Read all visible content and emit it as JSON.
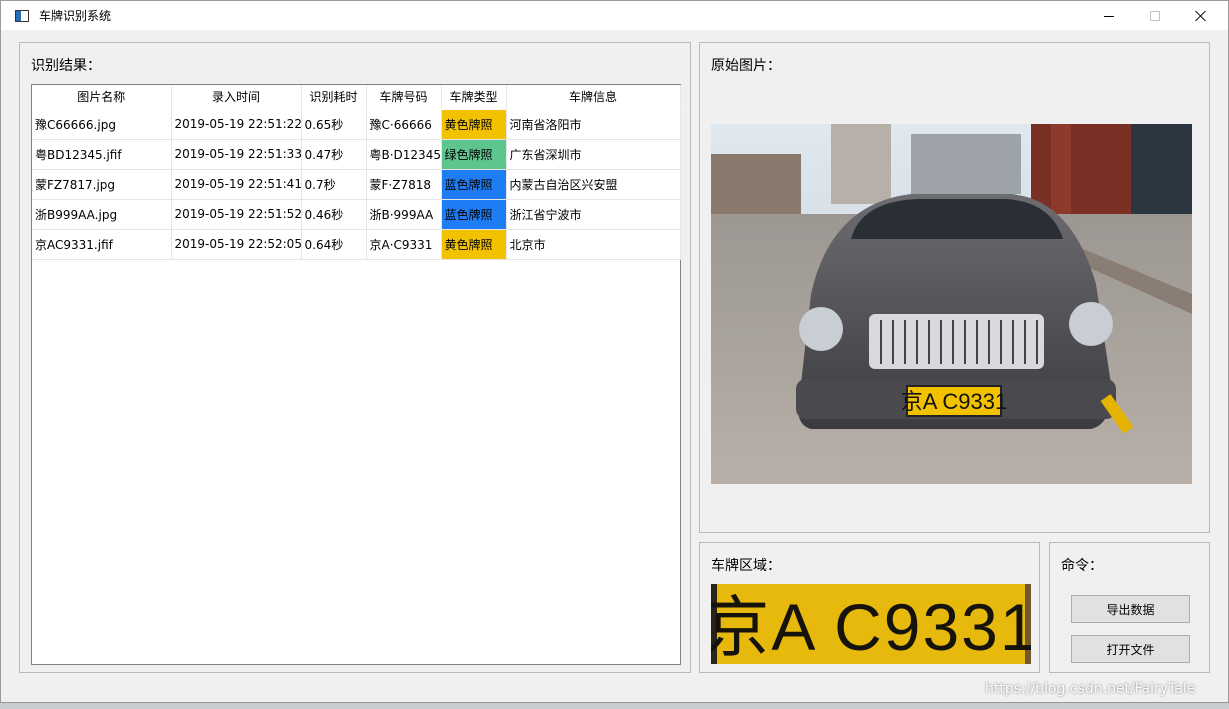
{
  "window": {
    "title": "车牌识别系统"
  },
  "results": {
    "title": "识别结果：",
    "columns": [
      "图片名称",
      "录入时间",
      "识别耗时",
      "车牌号码",
      "车牌类型",
      "车牌信息"
    ],
    "rows": [
      {
        "name": "豫C66666.jpg",
        "time": "2019-05-19 22:51:22",
        "cost": "0.65秒",
        "plate": "豫C·66666",
        "type": "黄色牌照",
        "type_color": "#f2c200",
        "info": "河南省洛阳市"
      },
      {
        "name": "粤BD12345.jfif",
        "time": "2019-05-19 22:51:33",
        "cost": "0.47秒",
        "plate": "粤B·D12345",
        "type": "绿色牌照",
        "type_color": "#5ec58f",
        "info": "广东省深圳市"
      },
      {
        "name": "蒙FZ7817.jpg",
        "time": "2019-05-19 22:51:41",
        "cost": "0.7秒",
        "plate": "蒙F·Z7818",
        "type": "蓝色牌照",
        "type_color": "#1e7cf5",
        "info": "内蒙古自治区兴安盟"
      },
      {
        "name": "浙B999AA.jpg",
        "time": "2019-05-19 22:51:52",
        "cost": "0.46秒",
        "plate": "浙B·999AA",
        "type": "蓝色牌照",
        "type_color": "#1e7cf5",
        "info": "浙江省宁波市"
      },
      {
        "name": "京AC9331.jfif",
        "time": "2019-05-19 22:52:05",
        "cost": "0.64秒",
        "plate": "京A·C9331",
        "type": "黄色牌照",
        "type_color": "#f2c200",
        "info": "北京市"
      }
    ]
  },
  "original": {
    "title": "原始图片：",
    "plate_text": "京A C9331"
  },
  "plate_region": {
    "title": "车牌区域：",
    "plate_text": "京A C9331"
  },
  "commands": {
    "title": "命令：",
    "export_label": "导出数据",
    "open_label": "打开文件"
  },
  "watermark": "https://blog.csdn.net/FairyTale"
}
